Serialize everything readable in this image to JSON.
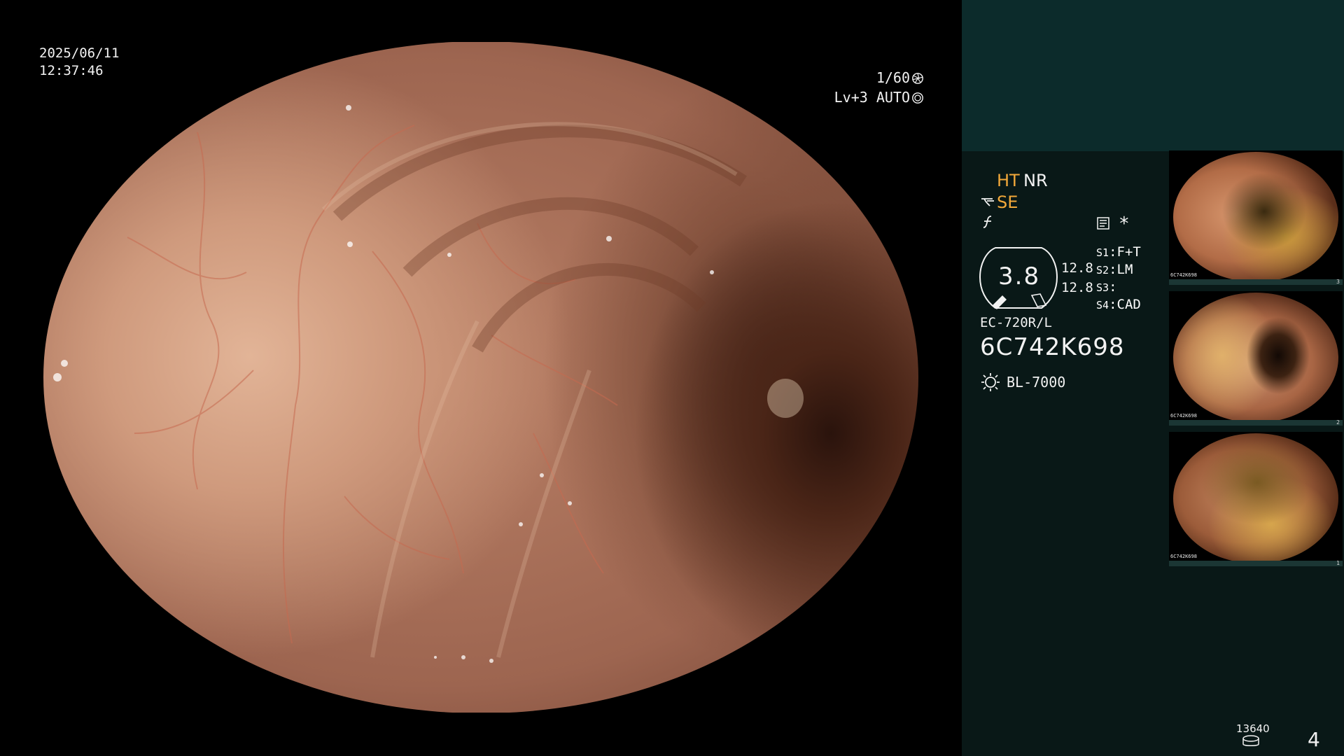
{
  "overlay": {
    "date": "2025/06/11",
    "time": "12:37:46",
    "shutter": "1/60",
    "level": "Lv+3 AUTO"
  },
  "panel": {
    "mode_ht": "HT",
    "mode_nr": "NR",
    "mode_se": "SE",
    "asterisk": "*",
    "gauge_value": "3.8",
    "gauge_line1": "12.8",
    "gauge_line2": "12.8",
    "slots": [
      {
        "key": "S1",
        "value": "F+T"
      },
      {
        "key": "S2",
        "value": "LM"
      },
      {
        "key": "S3",
        "value": ""
      },
      {
        "key": "S4",
        "value": "CAD"
      }
    ],
    "scope_model": "EC-720R/L",
    "serial": "6C742K698",
    "light_source": "BL-7000",
    "storage_count": "13640",
    "page_number": "4"
  },
  "thumbnails": [
    {
      "label": "6C742K698",
      "index": "3"
    },
    {
      "label": "6C742K698",
      "index": "2"
    },
    {
      "label": "6C742K698",
      "index": "1"
    }
  ],
  "colors": {
    "accent_orange": "#f2a83a",
    "panel_top": "#0c2b2b",
    "panel_bottom": "#091817"
  },
  "icons": {
    "shutter": "shutter-icon",
    "iris": "iris-icon",
    "structure": "structure-enhance-icon",
    "f_mode": "f-mode-icon",
    "document": "document-icon",
    "light": "light-source-icon",
    "disk": "storage-disk-icon"
  }
}
